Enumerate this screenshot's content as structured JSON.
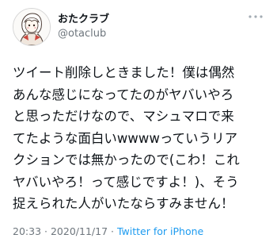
{
  "author": {
    "display_name": "おたクラブ",
    "handle": "@otaclub"
  },
  "tweet": {
    "text": "ツイート削除しときました！僕は偶然\nあんな感じになってたのがヤバいやろ\nと思っただけなので、マシュマロで来\nてたような面白いwwwwっていうリア\nクションでは無かったので(こわ！これ\nヤバいやろ！って感じですよ！)、そう\n捉えられた人がいたならすみません！"
  },
  "meta": {
    "time": "20:33",
    "separator": "·",
    "date": "2020/11/17",
    "source": "Twitter for iPhone"
  },
  "icons": {
    "more": "more-options-icon",
    "avatar": "avatar"
  },
  "colors": {
    "text": "#0f1419",
    "secondary": "#6e767d",
    "link": "#1d9bf0"
  }
}
